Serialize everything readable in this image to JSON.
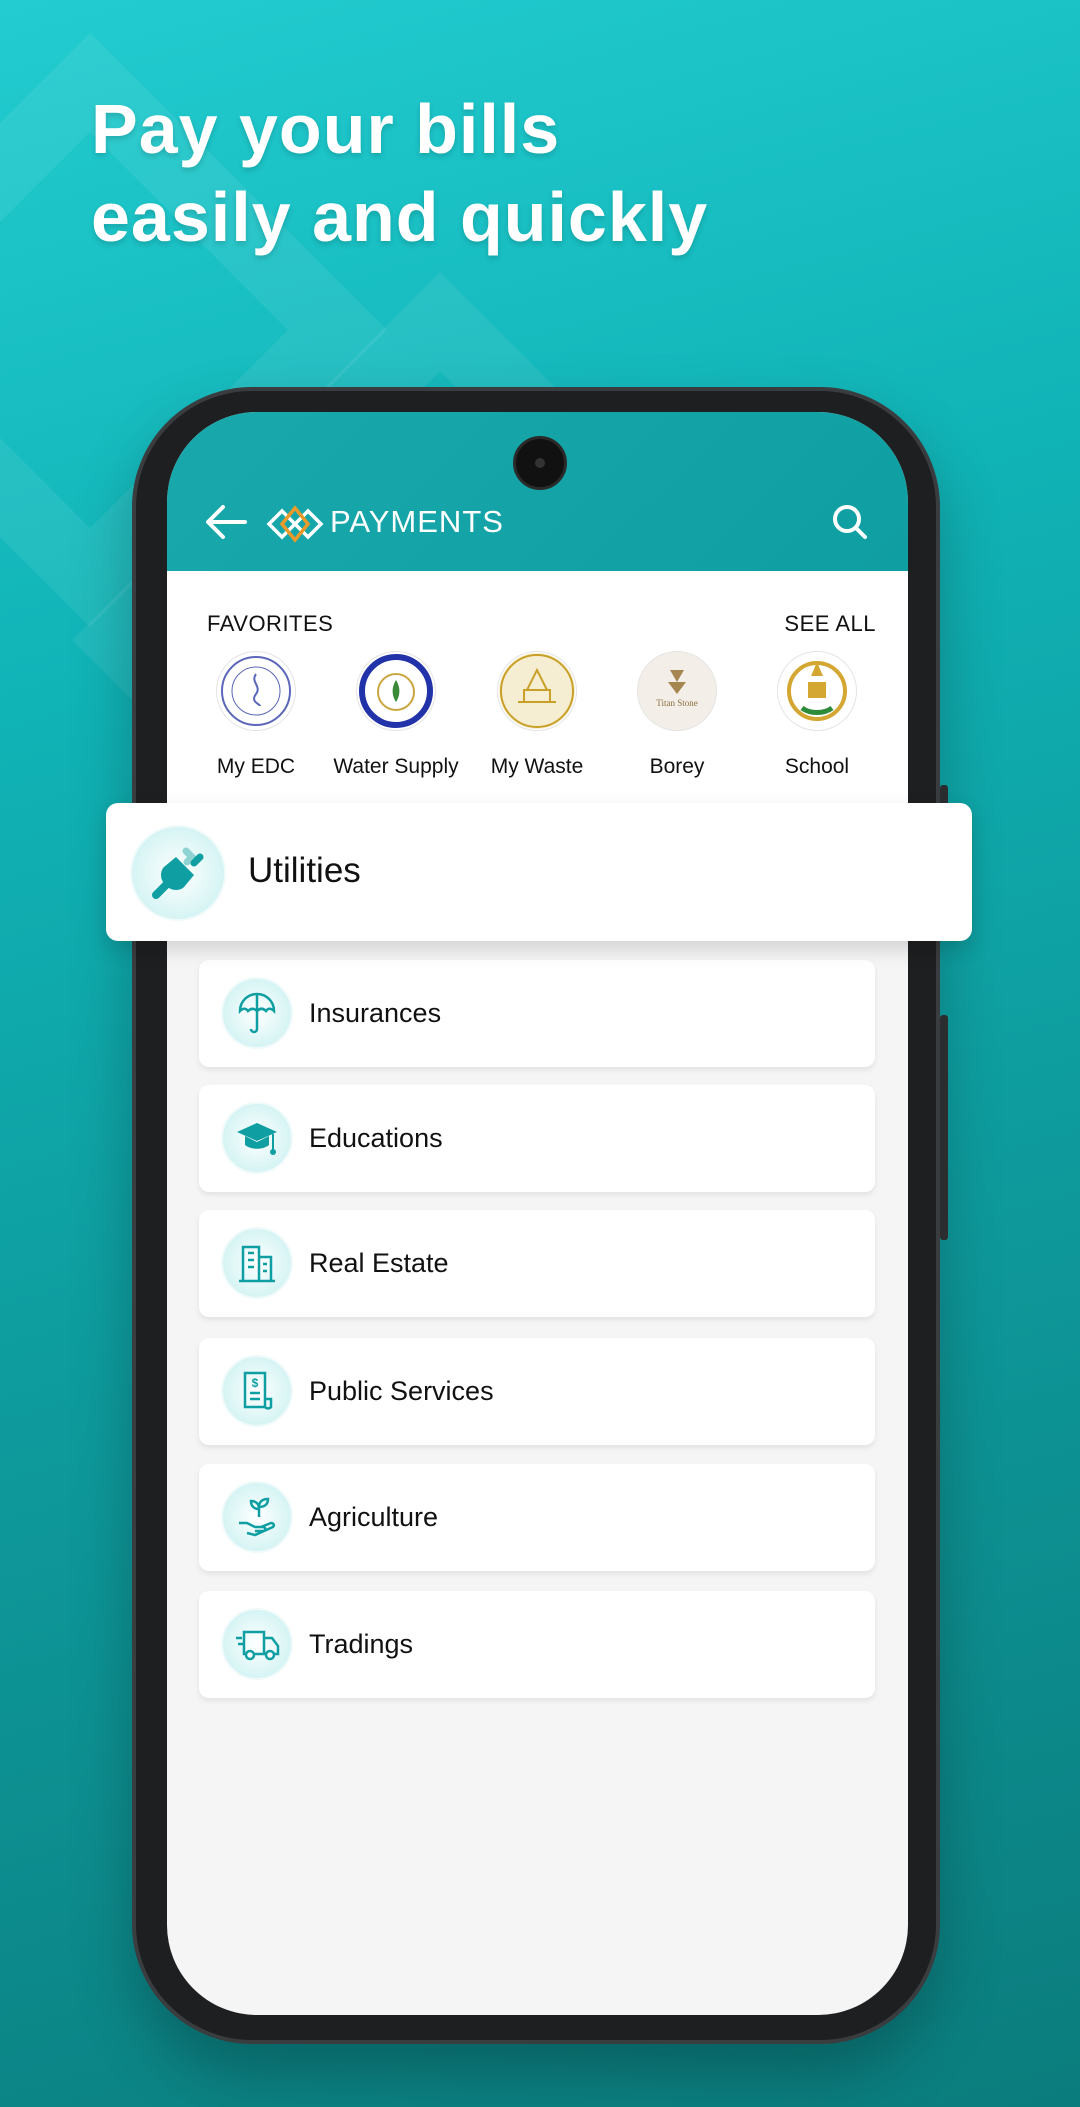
{
  "headline": {
    "line1": "Pay your bills",
    "line2": "easily and quickly"
  },
  "app": {
    "title": "PAYMENTS",
    "back_icon": "arrow-left-icon",
    "search_icon": "search-icon",
    "brand_color": "#0f9ea2",
    "accent_color": "#e89b2a"
  },
  "favorites": {
    "label": "FAVORITES",
    "see_all": "SEE ALL",
    "items": [
      {
        "name": "My EDC"
      },
      {
        "name": "Water Supply"
      },
      {
        "name": "My Waste"
      },
      {
        "name": "Borey"
      },
      {
        "name": "School"
      }
    ]
  },
  "highlight": {
    "label": "Utilities",
    "icon": "plug-icon"
  },
  "categories": [
    {
      "label": "Insurances",
      "icon": "umbrella-icon"
    },
    {
      "label": "Educations",
      "icon": "graduation-cap-icon"
    },
    {
      "label": "Real Estate",
      "icon": "building-icon"
    },
    {
      "label": "Public Services",
      "icon": "bill-document-icon"
    },
    {
      "label": "Agriculture",
      "icon": "plant-hand-icon"
    },
    {
      "label": "Tradings",
      "icon": "delivery-truck-icon"
    }
  ]
}
